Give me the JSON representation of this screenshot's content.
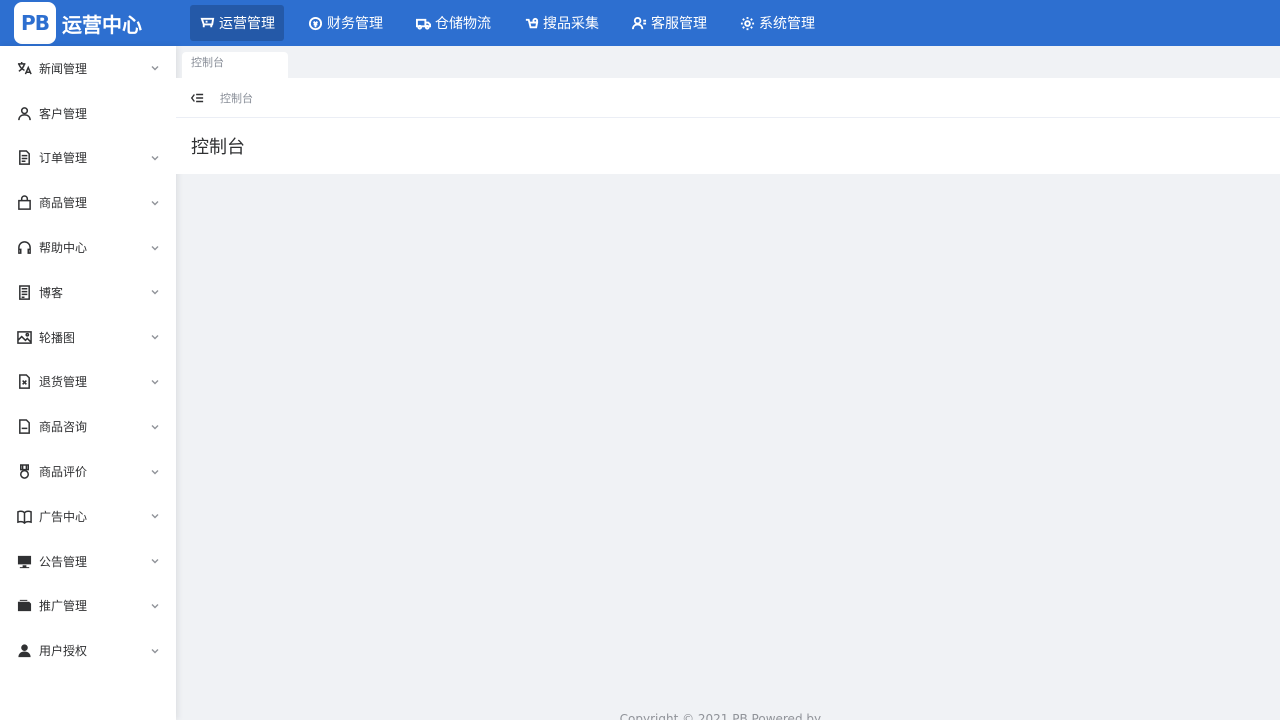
{
  "app": {
    "logo_badge": "PB",
    "title": "运营中心"
  },
  "topnav": [
    {
      "label": "运营管理",
      "icon": "shop-icon",
      "active": true
    },
    {
      "label": "财务管理",
      "icon": "finance-icon",
      "active": false
    },
    {
      "label": "仓储物流",
      "icon": "truck-icon",
      "active": false
    },
    {
      "label": "搜品采集",
      "icon": "search-goods-icon",
      "active": false
    },
    {
      "label": "客服管理",
      "icon": "user-service-icon",
      "active": false
    },
    {
      "label": "系统管理",
      "icon": "gear-icon",
      "active": false
    }
  ],
  "sidebar": {
    "items": [
      {
        "label": "新闻管理",
        "icon": "translate-icon",
        "has_children": true
      },
      {
        "label": "客户管理",
        "icon": "user-icon",
        "has_children": false
      },
      {
        "label": "订单管理",
        "icon": "document-icon",
        "has_children": true
      },
      {
        "label": "商品管理",
        "icon": "shopping-bag-icon",
        "has_children": true
      },
      {
        "label": "帮助中心",
        "icon": "headset-icon",
        "has_children": true
      },
      {
        "label": "博客",
        "icon": "article-icon",
        "has_children": true
      },
      {
        "label": "轮播图",
        "icon": "image-icon",
        "has_children": true
      },
      {
        "label": "退货管理",
        "icon": "file-x-icon",
        "has_children": true
      },
      {
        "label": "商品咨询",
        "icon": "file-icon",
        "has_children": true
      },
      {
        "label": "商品评价",
        "icon": "medal-icon",
        "has_children": true
      },
      {
        "label": "广告中心",
        "icon": "book-icon",
        "has_children": true
      },
      {
        "label": "公告管理",
        "icon": "monitor-icon",
        "has_children": true
      },
      {
        "label": "推广管理",
        "icon": "wallet-icon",
        "has_children": true
      },
      {
        "label": "用户授权",
        "icon": "user-filled-icon",
        "has_children": true
      }
    ]
  },
  "tabs": [
    {
      "label": "控制台"
    }
  ],
  "breadcrumb": {
    "current": "控制台"
  },
  "page": {
    "title": "控制台"
  },
  "footer": {
    "text": "Copyright © 2021 PB Powered by ..."
  },
  "colors": {
    "topbar": "#2d6fd0",
    "topnav_active": "#2459a8",
    "background": "#f0f2f5"
  }
}
